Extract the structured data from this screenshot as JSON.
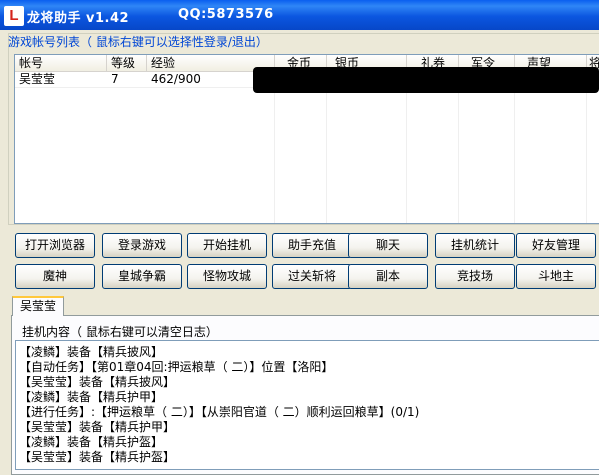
{
  "window": {
    "logo_letter": "L",
    "title": "龙将助手 v1.42",
    "qq": "QQ:5873576"
  },
  "account_group": {
    "caption": "游戏帐号列表（ 鼠标右键可以选择性登录/退出）",
    "columns": [
      "帐号",
      "等级",
      "经验",
      "金币",
      "银币",
      "礼券",
      "军令",
      "声望",
      "将"
    ],
    "rows": [
      {
        "account": "吴莹莹",
        "level": "7",
        "exp": "462/900"
      }
    ]
  },
  "buttons": {
    "row1": [
      "打开浏览器",
      "登录游戏",
      "开始挂机",
      "助手充值",
      "聊天",
      "挂机统计",
      "好友管理"
    ],
    "row2": [
      "魔神",
      "皇城争霸",
      "怪物攻城",
      "过关斩将",
      "副本",
      "竞技场",
      "斗地主"
    ]
  },
  "tab": {
    "label": "吴莹莹"
  },
  "log": {
    "caption": "挂机内容（ 鼠标右键可以清空日志）",
    "lines": [
      "【凌鳞】装备【精兵披风】",
      "【自动任务】【第01章04回:押运粮草（ 二）】位置【洛阳】",
      "【吴莹莹】装备【精兵披风】",
      "【凌鳞】装备【精兵护甲】",
      "【进行任务】:【押运粮草（ 二）】【从崇阳官道（ 二）顺利运回粮草】(0/1)",
      "【吴莹莹】装备【精兵护甲】",
      "【凌鳞】装备【精兵护盔】",
      "【吴莹莹】装备【精兵护盔】"
    ]
  }
}
